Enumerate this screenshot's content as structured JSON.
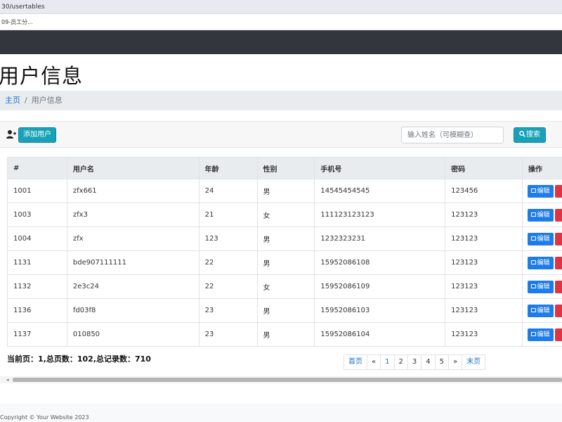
{
  "browser": {
    "url": "30/usertables",
    "bookmark": "09-员工分..."
  },
  "header": {
    "title": "用户信息"
  },
  "breadcrumb": {
    "home": "主页",
    "separator": "/",
    "current": "用户信息"
  },
  "toolbar": {
    "add_user_label": "添加用户",
    "add_user_icon": "user-plus-icon",
    "search_placeholder": "输入姓名（可模糊查）",
    "search_label": "搜索",
    "search_icon": "search-icon"
  },
  "table": {
    "columns": [
      "#",
      "用户名",
      "年龄",
      "性别",
      "手机号",
      "密码",
      "操作"
    ],
    "edit_label": "编辑",
    "rows": [
      {
        "id": "1001",
        "username": "zfx661",
        "age": "24",
        "gender": "男",
        "phone": "14545454545",
        "password": "123456"
      },
      {
        "id": "1003",
        "username": "zfx3",
        "age": "21",
        "gender": "女",
        "phone": "111123123123",
        "password": "123123"
      },
      {
        "id": "1004",
        "username": "zfx",
        "age": "123",
        "gender": "男",
        "phone": "1232323231",
        "password": "123123"
      },
      {
        "id": "1131",
        "username": "bde907111111",
        "age": "22",
        "gender": "男",
        "phone": "15952086108",
        "password": "123123"
      },
      {
        "id": "1132",
        "username": "2e3c24",
        "age": "22",
        "gender": "女",
        "phone": "15952086109",
        "password": "123123"
      },
      {
        "id": "1136",
        "username": "fd03f8",
        "age": "23",
        "gender": "男",
        "phone": "15952086103",
        "password": "123123"
      },
      {
        "id": "1137",
        "username": "010850",
        "age": "23",
        "gender": "男",
        "phone": "15952086104",
        "password": "123123"
      }
    ]
  },
  "pagination": {
    "info": "当前页：1,总页数：102,总记录数：710",
    "first": "首页",
    "prev": "«",
    "pages": [
      "1",
      "2",
      "3",
      "4",
      "5"
    ],
    "next": "»",
    "last": "末页"
  },
  "footer": {
    "text": "Copyright © Your Website 2023"
  },
  "colors": {
    "navbar": "#33373d",
    "primary": "#1e7ce8",
    "info": "#17a2b8",
    "danger": "#dc3545"
  }
}
